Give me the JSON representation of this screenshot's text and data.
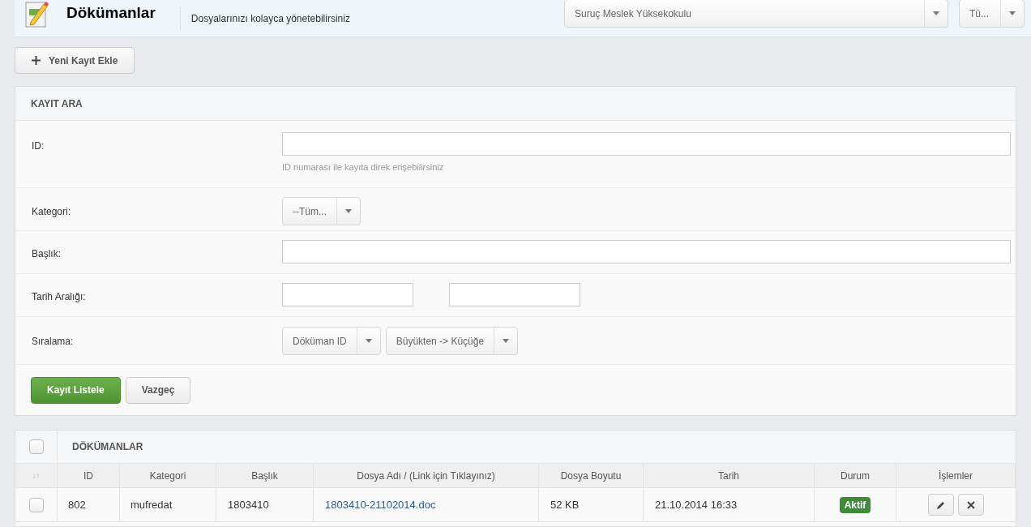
{
  "header": {
    "title": "Dökümanlar",
    "subtitle": "Dosyalarınızı kolayca yönetebilirsiniz",
    "selects": [
      "Suruç Meslek Yüksekokulu",
      "Tü..."
    ]
  },
  "add_button": "Yeni Kayıt Ekle",
  "search": {
    "title": "KAYIT ARA",
    "fields": [
      {
        "kind": "text",
        "label": "ID:",
        "help": "ID numarası ile kayıta direk erişebilirsiniz"
      },
      {
        "kind": "select",
        "label": "Kategori:",
        "options": [
          "--Tüm..."
        ]
      },
      {
        "kind": "text",
        "label": "Başlık:"
      },
      {
        "kind": "date_range",
        "label": "Tarih Aralığı:"
      },
      {
        "kind": "select",
        "label": "Sıralama:",
        "options": [
          "Döküman ID",
          "Büyükten -> Küçüğe"
        ]
      }
    ],
    "buttons": [
      {
        "label": "Kayıt Listele",
        "primary": true
      },
      {
        "label": "Vazgeç",
        "primary": false
      }
    ]
  },
  "table": {
    "title": "DÖKÜMANLAR",
    "select_all_checked": false,
    "sort_icon": "↓↑",
    "columns": [
      "ID",
      "Kategori",
      "Başlık",
      "Dosya Adı / (Link için Tıklayınız)",
      "Dosya Boyutu",
      "Tarih",
      "Durum",
      "İşlemler"
    ],
    "rows": [
      {
        "checked": false,
        "id": "802",
        "category": "mufredat",
        "title": "1803410",
        "file": "1803410-21102014.doc",
        "size": "52 KB",
        "date": "21.10.2014 16:33",
        "status": "Aktif",
        "active": true
      }
    ]
  }
}
